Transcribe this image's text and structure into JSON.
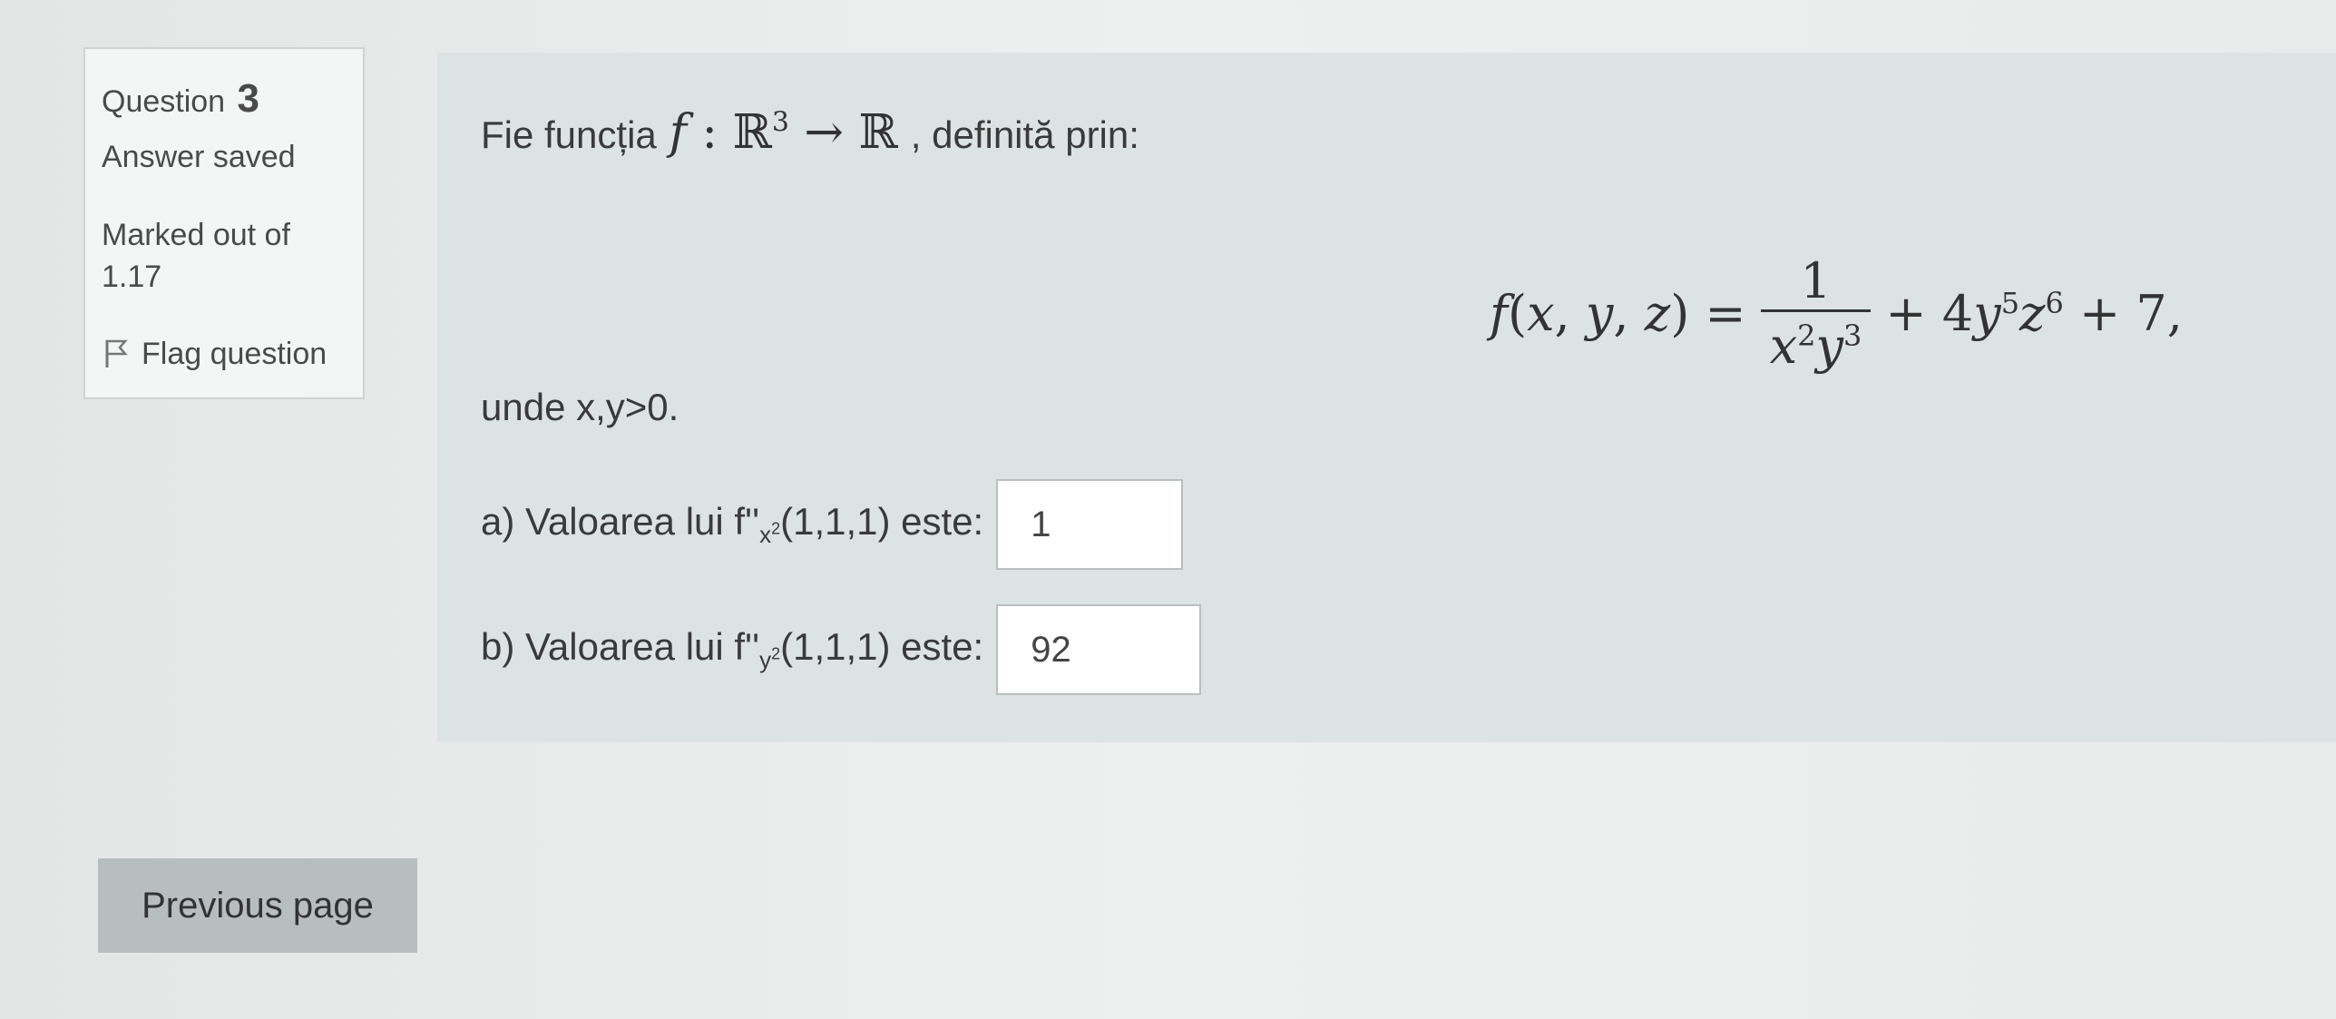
{
  "info": {
    "question_label": "Question",
    "question_number": "3",
    "state": "Answer saved",
    "grade_line1": "Marked out of",
    "grade_line2": "1.17",
    "flag_label": "Flag question"
  },
  "question": {
    "intro_before": "Fie funcția",
    "intro_after": ", definită prin:",
    "condition": "unde x,y>0.",
    "part_a": {
      "prefix": "a) Valoarea lui f''",
      "subscript": "x",
      "subscript_power": "2",
      "suffix": "(1,1,1) este:",
      "value": "1"
    },
    "part_b": {
      "prefix": "b) Valoarea lui f''",
      "subscript": "y",
      "subscript_power": "2",
      "suffix": "(1,1,1) este:",
      "value": "92"
    }
  },
  "navigation": {
    "previous_label": "Previous page"
  }
}
